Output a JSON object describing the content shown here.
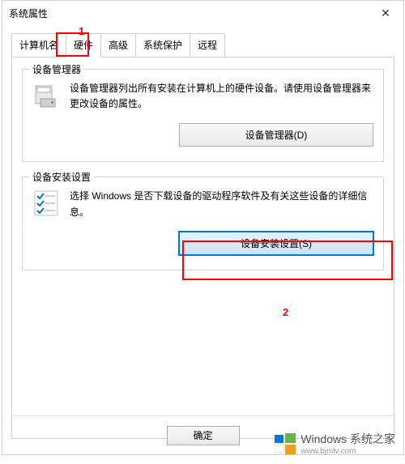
{
  "window": {
    "title": "系统属性",
    "close": "✕"
  },
  "annotations": {
    "label1": "1",
    "label2": "2"
  },
  "tabs": [
    {
      "label": "计算机名"
    },
    {
      "label": "硬件"
    },
    {
      "label": "高级"
    },
    {
      "label": "系统保护"
    },
    {
      "label": "远程"
    }
  ],
  "group1": {
    "title": "设备管理器",
    "text": "设备管理器列出所有安装在计算机上的硬件设备。请使用设备管理器来更改设备的属性。",
    "button": "设备管理器(D)"
  },
  "group2": {
    "title": "设备安装设置",
    "text": "选择 Windows 是否下载设备的驱动程序软件及有关这些设备的详细信息。",
    "button": "设备安装设置(S)"
  },
  "ok_button": "确定",
  "watermark": {
    "text": "Windows 系统之家",
    "url": "www.bjmlv.com"
  }
}
